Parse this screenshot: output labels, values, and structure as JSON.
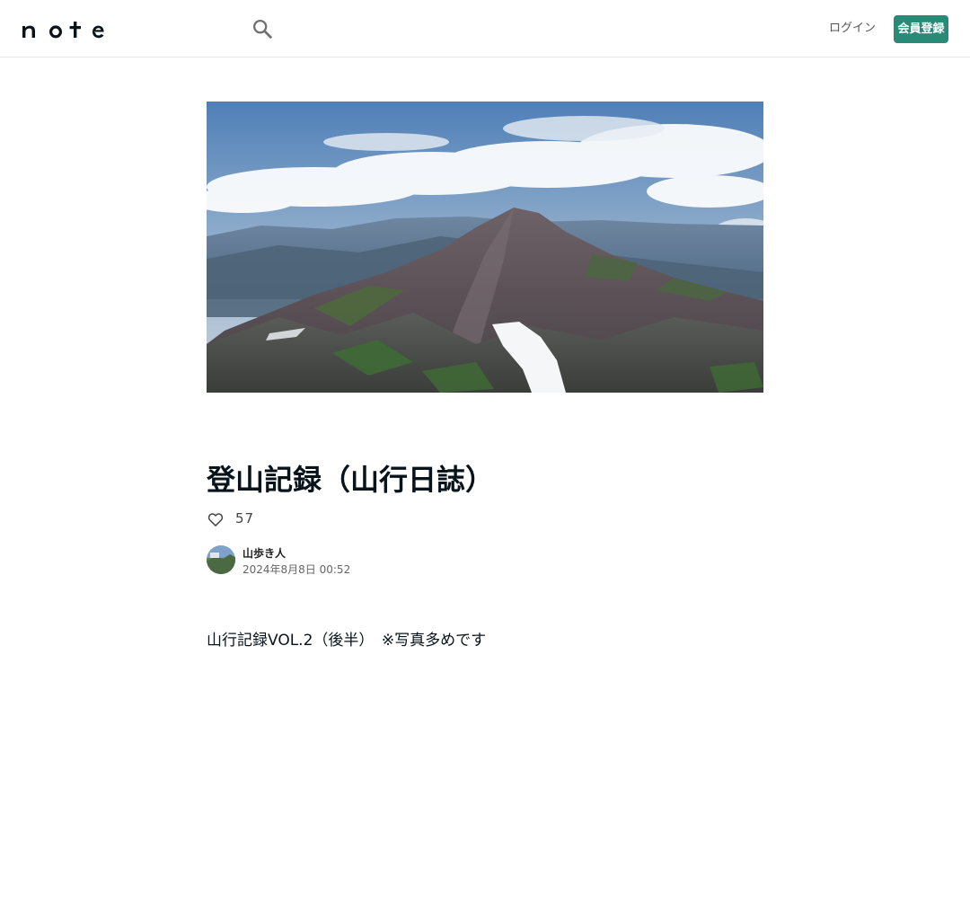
{
  "header": {
    "logo_text": "note",
    "search_icon": "search-icon",
    "login_label": "ログイン",
    "signup_label": "会員登録"
  },
  "article": {
    "hero_image": "mountain-ridge-photo",
    "title": "登山記録（山行日誌）",
    "like_icon": "heart-icon",
    "like_count": "57",
    "author": {
      "name": "山歩き人",
      "date": "2024年8月8日 00:52"
    },
    "body": "山行記録VOL.2（後半）　※写真多めです"
  },
  "colors": {
    "accent": "#2a8a78",
    "text": "#08131a",
    "border": "#e6e6e6"
  }
}
